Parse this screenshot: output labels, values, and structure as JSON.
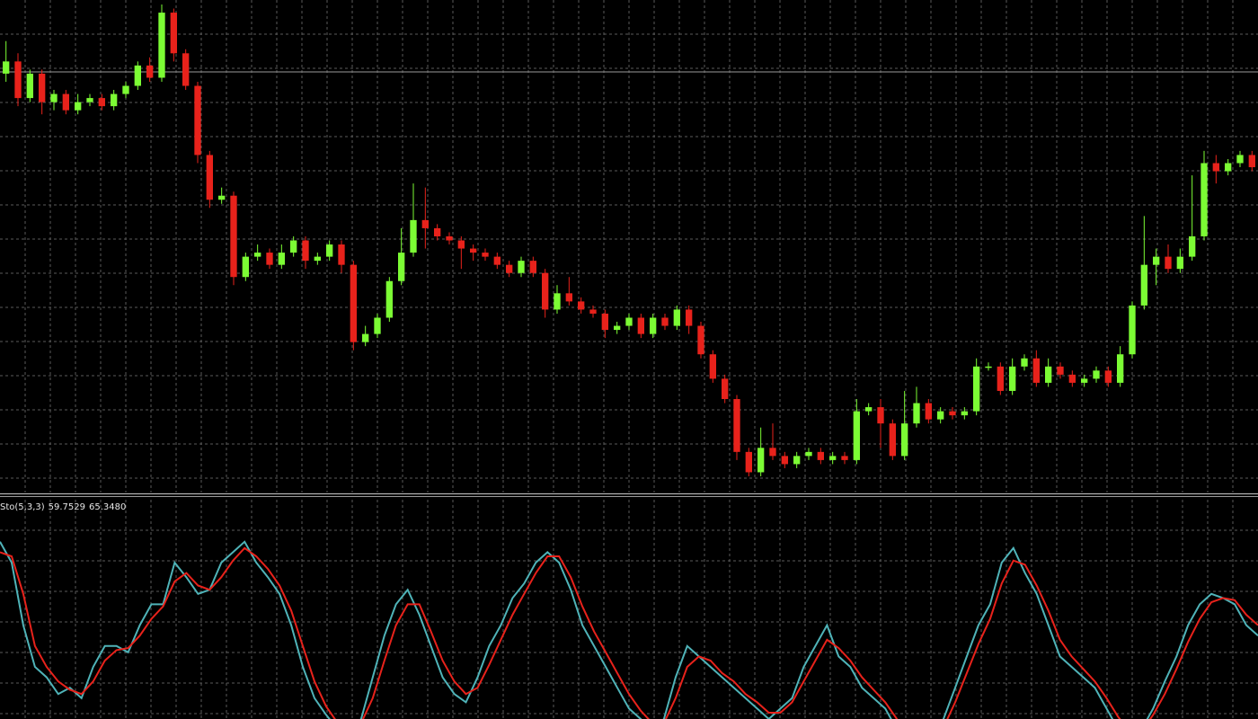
{
  "indicator": {
    "name": "Sto(5,3,3)",
    "main_value": "59.7529",
    "signal_value": "65.3480"
  },
  "colors": {
    "background": "#000000",
    "grid": "#5a5a5a",
    "bull_candle": "#7cfc34",
    "bear_candle": "#e8221b",
    "stoch_main": "#4fb3b8",
    "stoch_signal": "#e8221b"
  },
  "chart_data": [
    {
      "type": "candlestick",
      "grid": true,
      "candles": [
        [
          0.932,
          0.935,
          0.93,
          0.94
        ],
        [
          0.935,
          0.926,
          0.924,
          0.937
        ],
        [
          0.926,
          0.932,
          0.925,
          0.933
        ],
        [
          0.932,
          0.925,
          0.922,
          0.933
        ],
        [
          0.925,
          0.927,
          0.923,
          0.928
        ],
        [
          0.927,
          0.923,
          0.922,
          0.928
        ],
        [
          0.923,
          0.925,
          0.922,
          0.927
        ],
        [
          0.925,
          0.926,
          0.924,
          0.927
        ],
        [
          0.926,
          0.924,
          0.923,
          0.927
        ],
        [
          0.924,
          0.927,
          0.923,
          0.928
        ],
        [
          0.927,
          0.929,
          0.926,
          0.93
        ],
        [
          0.929,
          0.934,
          0.928,
          0.935
        ],
        [
          0.934,
          0.931,
          0.93,
          0.936
        ],
        [
          0.931,
          0.947,
          0.93,
          0.949
        ],
        [
          0.947,
          0.937,
          0.935,
          0.948
        ],
        [
          0.937,
          0.929,
          0.928,
          0.938
        ],
        [
          0.929,
          0.912,
          0.91,
          0.93
        ],
        [
          0.912,
          0.901,
          0.899,
          0.913
        ],
        [
          0.901,
          0.902,
          0.9,
          0.904
        ],
        [
          0.902,
          0.882,
          0.88,
          0.903
        ],
        [
          0.882,
          0.887,
          0.881,
          0.888
        ],
        [
          0.887,
          0.888,
          0.886,
          0.89
        ],
        [
          0.888,
          0.885,
          0.884,
          0.889
        ],
        [
          0.885,
          0.888,
          0.884,
          0.89
        ],
        [
          0.888,
          0.891,
          0.887,
          0.892
        ],
        [
          0.891,
          0.886,
          0.884,
          0.892
        ],
        [
          0.886,
          0.887,
          0.885,
          0.888
        ],
        [
          0.887,
          0.89,
          0.886,
          0.891
        ],
        [
          0.89,
          0.885,
          0.883,
          0.891
        ],
        [
          0.885,
          0.866,
          0.864,
          0.886
        ],
        [
          0.866,
          0.868,
          0.865,
          0.87
        ],
        [
          0.868,
          0.872,
          0.867,
          0.873
        ],
        [
          0.872,
          0.881,
          0.871,
          0.882
        ],
        [
          0.881,
          0.888,
          0.88,
          0.894
        ],
        [
          0.888,
          0.896,
          0.887,
          0.905
        ],
        [
          0.896,
          0.894,
          0.889,
          0.904
        ],
        [
          0.894,
          0.892,
          0.891,
          0.895
        ],
        [
          0.892,
          0.891,
          0.89,
          0.893
        ],
        [
          0.891,
          0.889,
          0.884,
          0.892
        ],
        [
          0.889,
          0.888,
          0.886,
          0.89
        ],
        [
          0.888,
          0.887,
          0.886,
          0.889
        ],
        [
          0.887,
          0.885,
          0.884,
          0.888
        ],
        [
          0.885,
          0.883,
          0.882,
          0.886
        ],
        [
          0.883,
          0.886,
          0.882,
          0.887
        ],
        [
          0.886,
          0.883,
          0.882,
          0.887
        ],
        [
          0.883,
          0.874,
          0.872,
          0.884
        ],
        [
          0.874,
          0.878,
          0.873,
          0.88
        ],
        [
          0.878,
          0.876,
          0.875,
          0.882
        ],
        [
          0.876,
          0.874,
          0.873,
          0.877
        ],
        [
          0.874,
          0.873,
          0.872,
          0.875
        ],
        [
          0.873,
          0.869,
          0.867,
          0.874
        ],
        [
          0.869,
          0.87,
          0.868,
          0.871
        ],
        [
          0.87,
          0.872,
          0.869,
          0.873
        ],
        [
          0.872,
          0.868,
          0.867,
          0.873
        ],
        [
          0.868,
          0.872,
          0.867,
          0.873
        ],
        [
          0.872,
          0.87,
          0.869,
          0.873
        ],
        [
          0.87,
          0.874,
          0.869,
          0.875
        ],
        [
          0.874,
          0.87,
          0.868,
          0.875
        ],
        [
          0.87,
          0.863,
          0.862,
          0.871
        ],
        [
          0.863,
          0.857,
          0.856,
          0.864
        ],
        [
          0.857,
          0.852,
          0.851,
          0.858
        ],
        [
          0.852,
          0.839,
          0.837,
          0.853
        ],
        [
          0.839,
          0.834,
          0.833,
          0.84
        ],
        [
          0.834,
          0.84,
          0.833,
          0.845
        ],
        [
          0.84,
          0.838,
          0.837,
          0.846
        ],
        [
          0.838,
          0.836,
          0.835,
          0.839
        ],
        [
          0.836,
          0.838,
          0.835,
          0.839
        ],
        [
          0.838,
          0.839,
          0.837,
          0.84
        ],
        [
          0.839,
          0.837,
          0.836,
          0.84
        ],
        [
          0.837,
          0.838,
          0.836,
          0.839
        ],
        [
          0.838,
          0.837,
          0.836,
          0.839
        ],
        [
          0.837,
          0.849,
          0.836,
          0.852
        ],
        [
          0.849,
          0.85,
          0.848,
          0.851
        ],
        [
          0.85,
          0.846,
          0.84,
          0.852
        ],
        [
          0.846,
          0.838,
          0.837,
          0.847
        ],
        [
          0.838,
          0.846,
          0.837,
          0.854
        ],
        [
          0.846,
          0.851,
          0.845,
          0.855
        ],
        [
          0.851,
          0.847,
          0.846,
          0.852
        ],
        [
          0.847,
          0.849,
          0.846,
          0.85
        ],
        [
          0.849,
          0.848,
          0.847,
          0.85
        ],
        [
          0.848,
          0.849,
          0.847,
          0.85
        ],
        [
          0.849,
          0.86,
          0.848,
          0.862
        ],
        [
          0.86,
          0.86,
          0.859,
          0.861
        ],
        [
          0.86,
          0.854,
          0.853,
          0.861
        ],
        [
          0.854,
          0.86,
          0.853,
          0.862
        ],
        [
          0.86,
          0.862,
          0.859,
          0.863
        ],
        [
          0.862,
          0.856,
          0.855,
          0.864
        ],
        [
          0.856,
          0.86,
          0.855,
          0.862
        ],
        [
          0.86,
          0.858,
          0.857,
          0.861
        ],
        [
          0.858,
          0.856,
          0.855,
          0.859
        ],
        [
          0.856,
          0.857,
          0.855,
          0.858
        ],
        [
          0.857,
          0.859,
          0.856,
          0.86
        ],
        [
          0.859,
          0.856,
          0.855,
          0.86
        ],
        [
          0.856,
          0.863,
          0.855,
          0.865
        ],
        [
          0.863,
          0.875,
          0.862,
          0.876
        ],
        [
          0.875,
          0.885,
          0.874,
          0.897
        ],
        [
          0.885,
          0.887,
          0.88,
          0.889
        ],
        [
          0.887,
          0.884,
          0.883,
          0.89
        ],
        [
          0.884,
          0.887,
          0.883,
          0.889
        ],
        [
          0.887,
          0.892,
          0.886,
          0.907
        ],
        [
          0.892,
          0.91,
          0.891,
          0.913
        ],
        [
          0.91,
          0.908,
          0.905,
          0.912
        ],
        [
          0.908,
          0.91,
          0.907,
          0.911
        ],
        [
          0.91,
          0.912,
          0.909,
          0.913
        ],
        [
          0.912,
          0.909,
          0.908,
          0.913
        ]
      ]
    },
    {
      "type": "line",
      "title": "Sto(5,3,3) 59.7529 65.3480",
      "ylim": [
        0,
        100
      ],
      "grid": true,
      "series": [
        {
          "values": [
            85,
            75,
            45,
            25,
            20,
            12,
            15,
            10,
            25,
            35,
            35,
            32,
            45,
            55,
            55,
            75,
            68,
            60,
            62,
            75,
            80,
            85,
            75,
            68,
            60,
            45,
            25,
            10,
            2,
            -5,
            -5,
            0,
            20,
            40,
            55,
            62,
            50,
            35,
            20,
            12,
            8,
            20,
            35,
            45,
            58,
            65,
            75,
            80,
            75,
            62,
            45,
            35,
            25,
            15,
            5,
            0,
            -5,
            0,
            20,
            35,
            30,
            25,
            20,
            15,
            10,
            5,
            0,
            5,
            10,
            25,
            35,
            45,
            30,
            25,
            15,
            10,
            5,
            -5,
            -10,
            -15,
            -10,
            0,
            15,
            30,
            45,
            55,
            75,
            82,
            70,
            60,
            45,
            30,
            25,
            20,
            15,
            5,
            -5,
            -10,
            -5,
            5,
            18,
            30,
            45,
            55,
            60,
            58,
            55,
            45,
            40
          ]
        },
        {
          "values": [
            80,
            78,
            60,
            35,
            25,
            18,
            14,
            12,
            18,
            28,
            33,
            34,
            40,
            48,
            54,
            66,
            70,
            64,
            62,
            68,
            76,
            82,
            78,
            72,
            64,
            52,
            35,
            18,
            6,
            -2,
            -4,
            -2,
            10,
            28,
            45,
            55,
            55,
            42,
            28,
            18,
            12,
            15,
            26,
            38,
            50,
            60,
            70,
            78,
            78,
            68,
            54,
            42,
            32,
            22,
            12,
            4,
            -2,
            -2,
            10,
            25,
            30,
            28,
            22,
            18,
            12,
            8,
            3,
            3,
            8,
            18,
            28,
            38,
            34,
            28,
            20,
            14,
            8,
            0,
            -6,
            -12,
            -12,
            -4,
            8,
            22,
            36,
            48,
            65,
            76,
            74,
            64,
            52,
            38,
            30,
            24,
            18,
            10,
            1,
            -6,
            -6,
            2,
            12,
            24,
            37,
            48,
            56,
            58,
            57,
            50,
            45
          ]
        }
      ]
    }
  ]
}
